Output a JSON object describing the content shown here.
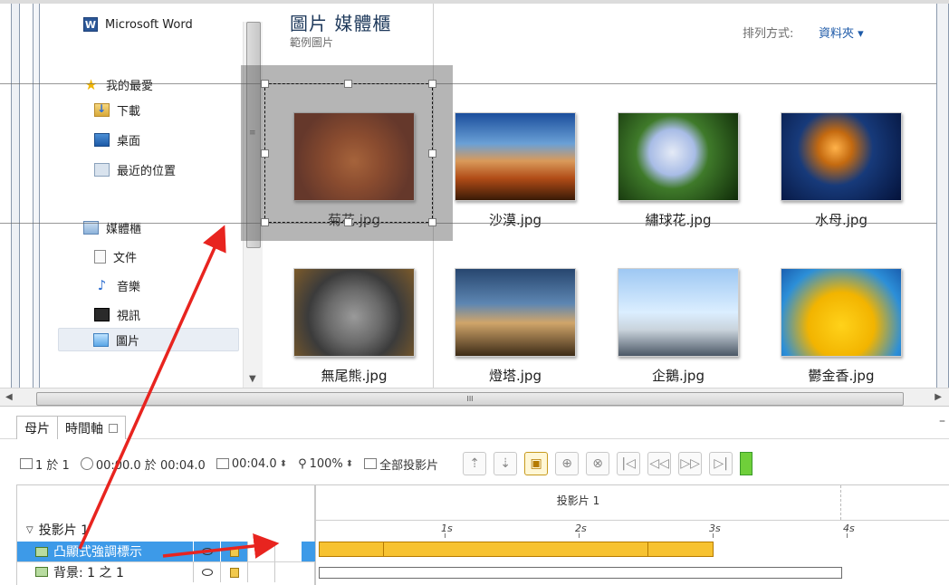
{
  "nav": {
    "items": [
      {
        "label": "Microsoft Word",
        "icon": "word-icon"
      },
      {
        "label": "我的最愛",
        "icon": "star-icon"
      },
      {
        "label": "下載",
        "icon": "download-folder-icon"
      },
      {
        "label": "桌面",
        "icon": "desktop-icon"
      },
      {
        "label": "最近的位置",
        "icon": "recent-places-icon"
      },
      {
        "label": "媒體櫃",
        "icon": "library-icon"
      },
      {
        "label": "文件",
        "icon": "documents-icon"
      },
      {
        "label": "音樂",
        "icon": "music-icon"
      },
      {
        "label": "視訊",
        "icon": "video-icon"
      },
      {
        "label": "圖片",
        "icon": "pictures-icon",
        "selected": true
      }
    ]
  },
  "content": {
    "library_title": "圖片 媒體櫃",
    "library_subtitle": "範例圖片",
    "arrange_label": "排列方式:",
    "arrange_value": "資料夾 ▾",
    "thumbnails": [
      {
        "caption": "菊花.jpg"
      },
      {
        "caption": "沙漠.jpg"
      },
      {
        "caption": "繡球花.jpg"
      },
      {
        "caption": "水母.jpg"
      },
      {
        "caption": "無尾熊.jpg"
      },
      {
        "caption": "燈塔.jpg"
      },
      {
        "caption": "企鵝.jpg"
      },
      {
        "caption": "鬱金香.jpg"
      }
    ]
  },
  "scrollbar": {
    "grip": "III"
  },
  "timeline": {
    "tabs": [
      {
        "label": "母片"
      },
      {
        "label": "時間軸"
      }
    ],
    "toolbar": {
      "slide_count": "1 於 1",
      "time_position": "00:00.0 於 00:04.0",
      "duration": "00:04.0",
      "zoom": "100%",
      "project_all": "全部投影片"
    },
    "slide_header": "投影片 1",
    "ruler_labels": [
      "1s",
      "2s",
      "3s",
      "4s"
    ],
    "rows": {
      "slide": "投影片 1",
      "animation": "凸顯式強調標示",
      "background": "背景: 1 之 1"
    }
  },
  "colors": {
    "selection": "#3d9ae8",
    "bar_fill": "#f7c230",
    "arrow": "#e8241f"
  }
}
